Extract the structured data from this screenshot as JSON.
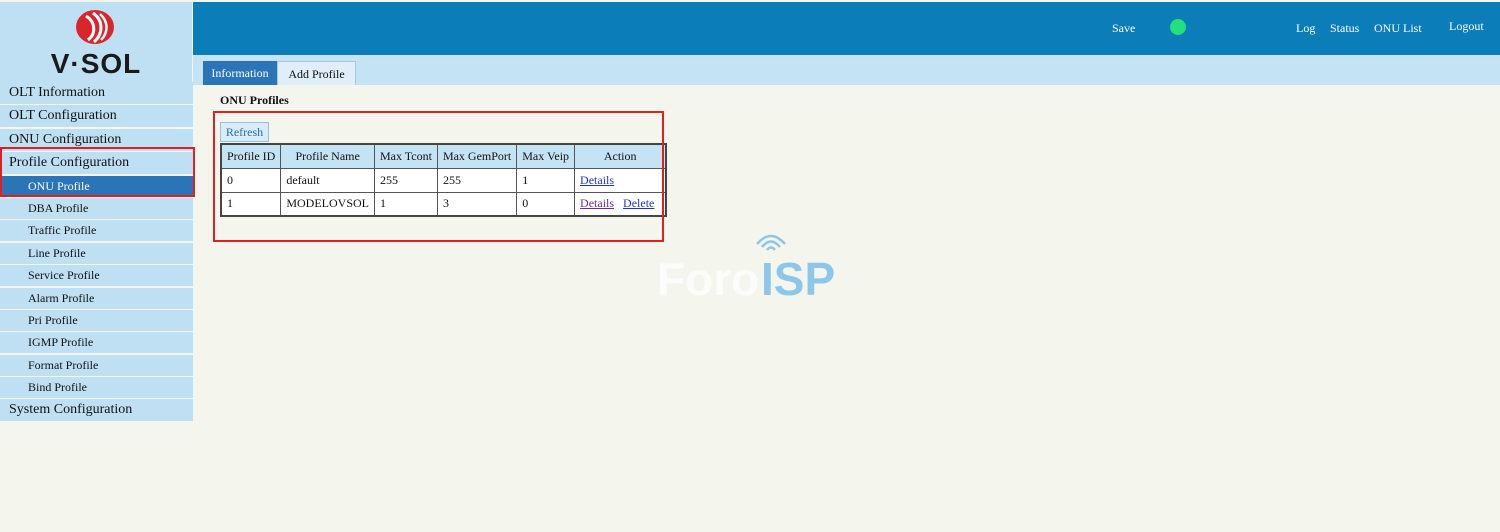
{
  "brand": {
    "logo_text": "V·SOL"
  },
  "header": {
    "save": "Save",
    "links": [
      "Log",
      "Status",
      "ONU List"
    ],
    "logout": "Logout",
    "status_color": "#22e07a"
  },
  "tabs": [
    {
      "label": "Information",
      "active": true
    },
    {
      "label": "Add Profile",
      "active": false
    }
  ],
  "sidebar": {
    "olt_information": "OLT Information",
    "olt_configuration": "OLT Configuration",
    "onu_configuration": "ONU Configuration",
    "profile_configuration": "Profile Configuration",
    "sub_items": [
      "ONU Profile",
      "DBA Profile",
      "Traffic Profile",
      "Line Profile",
      "Service Profile",
      "Alarm Profile",
      "Pri Profile",
      "IGMP Profile",
      "Format Profile",
      "Bind Profile"
    ],
    "system_configuration": "System Configuration"
  },
  "main": {
    "section_title": "ONU Profiles",
    "refresh_label": "Refresh",
    "table": {
      "headers": [
        "Profile ID",
        "Profile Name",
        "Max Tcont",
        "Max GemPort",
        "Max Veip",
        "Action"
      ],
      "rows": [
        {
          "id": "0",
          "name": "default",
          "max_tcont": "255",
          "max_gemport": "255",
          "max_veip": "1",
          "details": "Details",
          "delete": ""
        },
        {
          "id": "1",
          "name": "MODELOVSOL",
          "max_tcont": "1",
          "max_gemport": "3",
          "max_veip": "0",
          "details": "Details",
          "delete": "Delete"
        }
      ]
    }
  },
  "watermark": {
    "part1": "Foro",
    "part2": "ISP"
  }
}
